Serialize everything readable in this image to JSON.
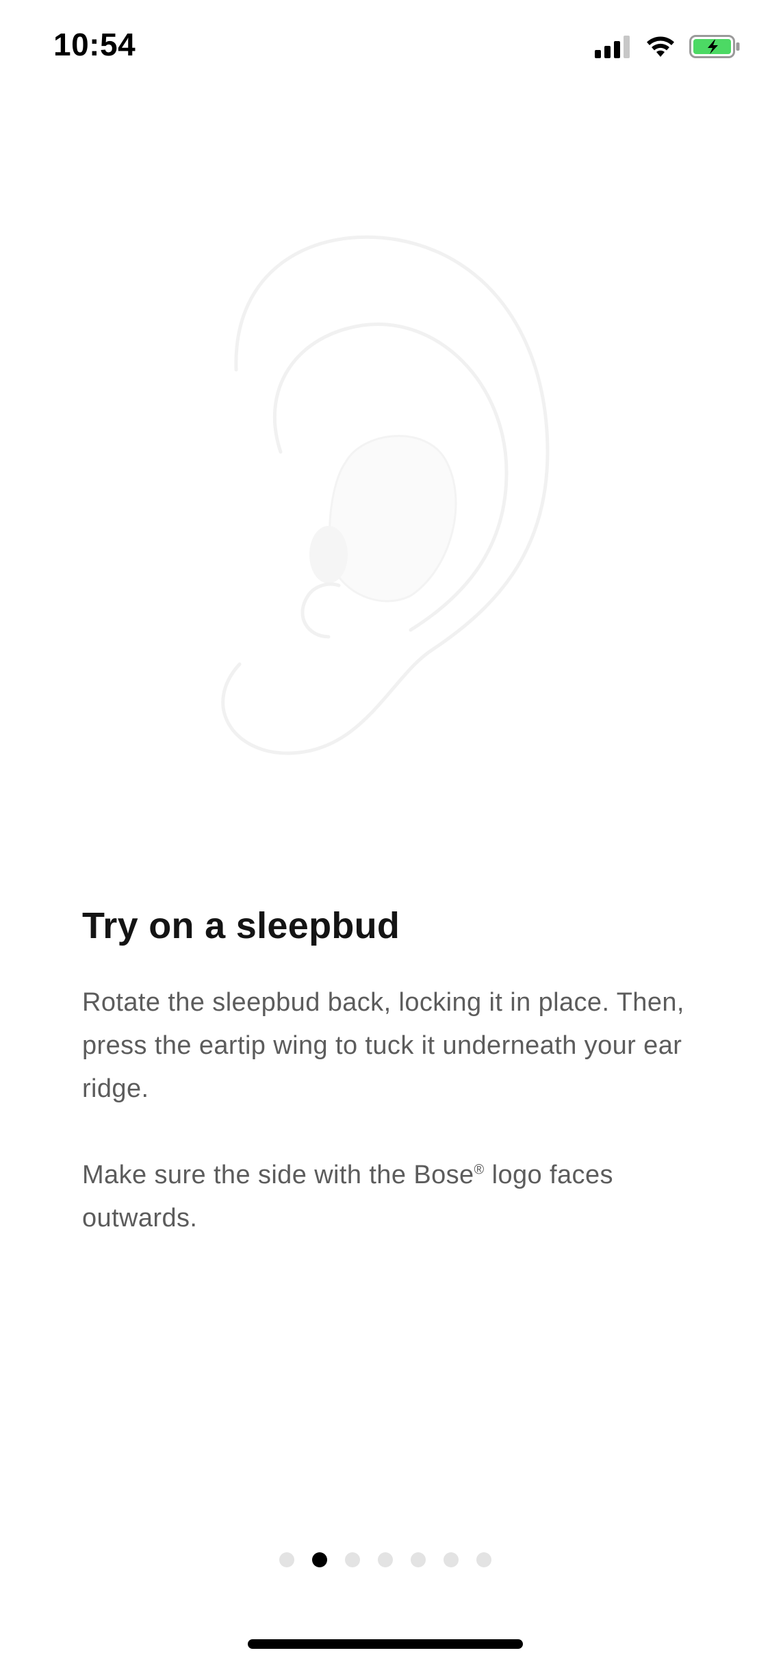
{
  "status_bar": {
    "time": "10:54",
    "icons": [
      "signal-icon",
      "wifi-icon",
      "battery-charging-icon"
    ],
    "battery_color": "#4cd964"
  },
  "illustration": {
    "icon": "ear-with-sleepbud-illustration"
  },
  "content": {
    "title": "Try on a sleepbud",
    "paragraph_1": "Rotate the sleepbud back, locking it in place. Then, press the eartip wing to tuck it underneath your ear ridge.",
    "paragraph_2_before": "Make sure the side with the Bose",
    "paragraph_2_registered": "®",
    "paragraph_2_after": " logo faces outwards."
  },
  "pager": {
    "total": 7,
    "current": 2
  }
}
